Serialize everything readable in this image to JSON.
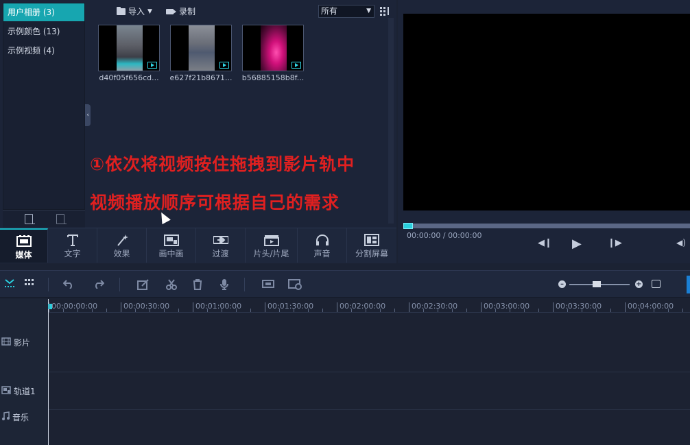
{
  "library": {
    "albums": [
      {
        "label": "用户相册 (3)",
        "active": true
      },
      {
        "label": "示例颜色 (13)",
        "active": false
      },
      {
        "label": "示例视频 (4)",
        "active": false
      }
    ],
    "toolbar": {
      "import_label": "导入",
      "import_arrow": "▼",
      "record_label": "录制",
      "filter_value": "所有",
      "filter_arrow": "▼"
    },
    "thumbnails": [
      {
        "label": "d40f05f656cd..."
      },
      {
        "label": "e627f21b8671..."
      },
      {
        "label": "b56885158b8f..."
      }
    ],
    "collapse_glyph": "‹"
  },
  "annotation": {
    "line1": "①依次将视频按住拖拽到影片轨中",
    "line2": "视频播放顺序可根据自己的需求"
  },
  "tabs": [
    {
      "label": "媒体",
      "icon": "film-icon",
      "active": true
    },
    {
      "label": "文字",
      "icon": "text-icon",
      "active": false
    },
    {
      "label": "效果",
      "icon": "magic-wand-icon",
      "active": false
    },
    {
      "label": "画中画",
      "icon": "picture-in-picture-icon",
      "active": false
    },
    {
      "label": "过渡",
      "icon": "transition-icon",
      "active": false
    },
    {
      "label": "片头/片尾",
      "icon": "clapper-icon",
      "active": false
    },
    {
      "label": "声音",
      "icon": "headphones-icon",
      "active": false
    },
    {
      "label": "分割屏幕",
      "icon": "split-screen-icon",
      "active": false
    }
  ],
  "preview": {
    "time": "00:00:00 / 00:00:00",
    "progress": 0,
    "prev_glyph": "◀❙",
    "play_glyph": "▶",
    "next_glyph": "❙▶",
    "volume_glyph": "◀)"
  },
  "timeline": {
    "ruler": [
      "00:00:00:00",
      "00:00:30:00",
      "00:01:00:00",
      "00:01:30:00",
      "00:02:00:00",
      "00:02:30:00",
      "00:03:00:00",
      "00:03:30:00",
      "00:04:00:00"
    ],
    "tracks": [
      {
        "label": "影片",
        "icon": "film-strip-icon"
      },
      {
        "label": "轨道1",
        "icon": "overlay-track-icon"
      },
      {
        "label": "音乐",
        "icon": "music-note-icon"
      }
    ],
    "zoom_level": 0.45,
    "toolbar_icons": [
      "storyboard-icon",
      "grid-view-icon",
      "undo-icon",
      "redo-icon",
      "edit-icon",
      "scissors-icon",
      "trash-icon",
      "microphone-icon",
      "crop-icon",
      "render-icon"
    ],
    "zoom_minus_glyph": "–",
    "zoom_plus_glyph": "+"
  },
  "colors": {
    "accent": "#17a6b0",
    "annotation": "#e02020",
    "background": "#1b2233"
  }
}
